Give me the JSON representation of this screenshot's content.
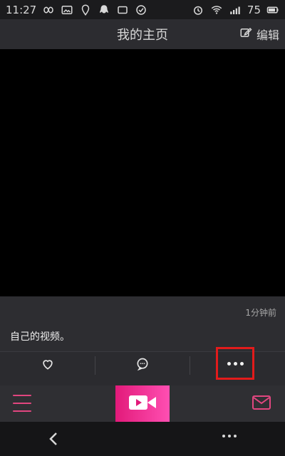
{
  "status_bar": {
    "time": "11:27",
    "battery_text": "75",
    "left_icons": [
      "infinity-icon",
      "image-icon",
      "badge-icon",
      "penguin-icon",
      "post-icon",
      "check-icon"
    ],
    "right_icons": [
      "alarm-icon",
      "wifi-icon",
      "signal-icon",
      "battery-icon"
    ]
  },
  "header": {
    "title": "我的主页",
    "edit_label": "编辑",
    "edit_icon": "edit-icon"
  },
  "post": {
    "time": "1分钟前",
    "caption": "自己的视频。"
  },
  "actions": {
    "like_icon": "heart-icon",
    "comment_icon": "comment-icon",
    "more_icon": "more-dots-icon",
    "highlight_color": "#e21b1b"
  },
  "tabbar": {
    "accent_color": "#e1467f",
    "icons": [
      "menu-icon",
      "video-camera-icon",
      "mail-icon"
    ]
  },
  "navbar": {
    "icons": [
      "back-icon",
      "more-dots-icon"
    ]
  }
}
